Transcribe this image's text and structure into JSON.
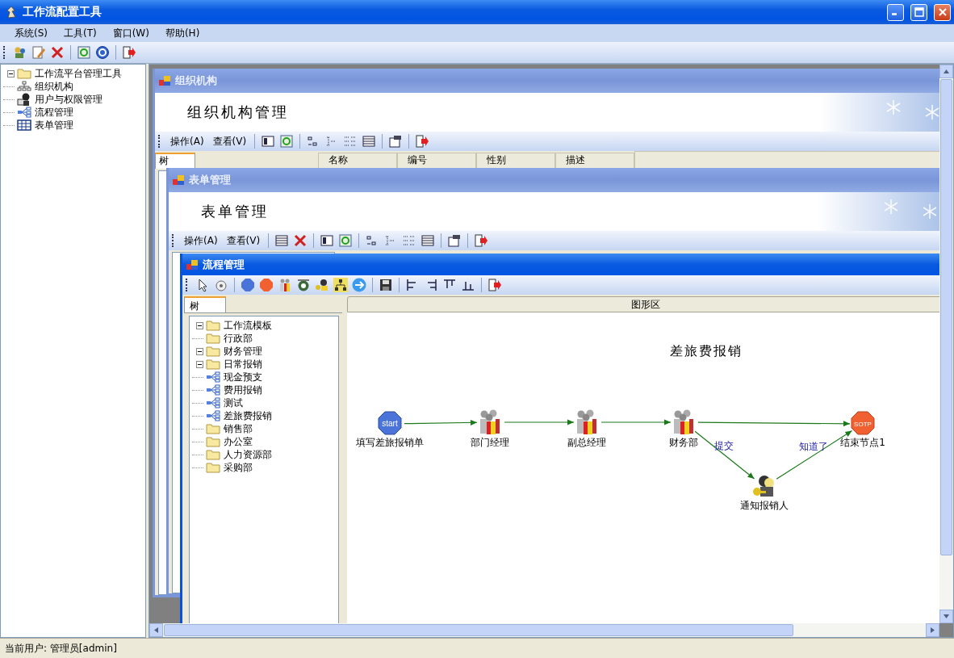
{
  "window": {
    "title": "工作流配置工具"
  },
  "menu": [
    "系统(S)",
    "工具(T)",
    "窗口(W)",
    "帮助(H)"
  ],
  "nav_tree": {
    "label": "工作流平台管理工具",
    "kind": "folder",
    "expanded": true,
    "children": [
      {
        "label": "组织机构",
        "kind": "org"
      },
      {
        "label": "用户与权限管理",
        "kind": "users"
      },
      {
        "label": "流程管理",
        "kind": "flow"
      },
      {
        "label": "表单管理",
        "kind": "form"
      }
    ]
  },
  "org_window": {
    "title": "组织机构",
    "banner": "组织机构管理",
    "menus": [
      "操作(A)",
      "查看(V)"
    ],
    "tab": "树",
    "columns": [
      "名称",
      "编号",
      "性别",
      "描述"
    ]
  },
  "form_window": {
    "title": "表单管理",
    "banner": "表单管理",
    "menus": [
      "操作(A)",
      "查看(V)"
    ]
  },
  "flow_window": {
    "title": "流程管理",
    "tab": {
      "label": "树",
      "selected": true
    },
    "canvas_header": "图形区",
    "template_tree": {
      "label": "工作流模板",
      "kind": "folder",
      "expanded": true,
      "children": [
        {
          "label": "行政部",
          "kind": "folder"
        },
        {
          "label": "财务管理",
          "kind": "folder",
          "expanded": true,
          "children": [
            {
              "label": "日常报销",
              "kind": "folder",
              "expanded": true,
              "children": [
                {
                  "label": "现金预支",
                  "kind": "flow"
                },
                {
                  "label": "费用报销",
                  "kind": "flow"
                },
                {
                  "label": "测试",
                  "kind": "flow"
                },
                {
                  "label": "差旅费报销",
                  "kind": "flow"
                }
              ]
            }
          ]
        },
        {
          "label": "销售部",
          "kind": "folder"
        },
        {
          "label": "办公室",
          "kind": "folder"
        },
        {
          "label": "人力资源部",
          "kind": "folder"
        },
        {
          "label": "采购部",
          "kind": "folder"
        }
      ]
    },
    "diagram": {
      "title": "差旅费报销",
      "nodes": [
        {
          "label": "填写差旅报销单",
          "kind": "start",
          "badge": "start"
        },
        {
          "label": "部门经理",
          "kind": "role"
        },
        {
          "label": "副总经理",
          "kind": "role"
        },
        {
          "label": "财务部",
          "kind": "role"
        },
        {
          "label": "结束节点1",
          "kind": "end",
          "badge": "SOTP"
        },
        {
          "label": "通知报销人",
          "kind": "notify"
        }
      ],
      "edges": [
        {
          "kind": "plain"
        },
        {
          "kind": "plain"
        },
        {
          "kind": "plain"
        },
        {
          "kind": "plain"
        },
        {
          "kind": "labelled",
          "label": "提交"
        },
        {
          "kind": "labelled",
          "label": "知道了"
        }
      ]
    }
  },
  "status_bar": {
    "text": "当前用户: 管理员[admin]"
  }
}
